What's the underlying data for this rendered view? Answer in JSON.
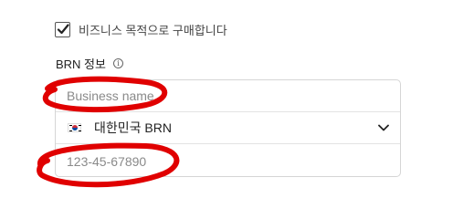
{
  "business_purchase": {
    "checked": true,
    "label": "비즈니스 목적으로 구매합니다"
  },
  "brn": {
    "section_label": "BRN 정보",
    "info_icon": "info-icon",
    "business_name_placeholder": "Business name",
    "business_name_value": "",
    "country_selector": {
      "flag": "south-korea-flag-icon",
      "selected": "대한민국 BRN"
    },
    "brn_placeholder": "123-45-67890",
    "brn_value": ""
  },
  "annotation_color": "#e00000"
}
